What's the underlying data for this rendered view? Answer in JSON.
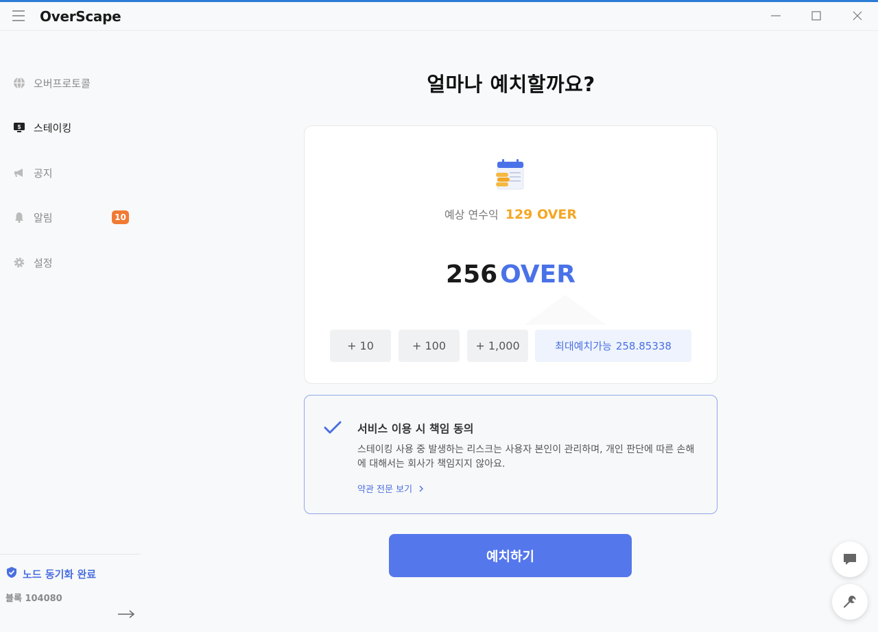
{
  "app": {
    "title": "OverScape"
  },
  "sidebar": {
    "items": [
      {
        "label": "오버프로토콜",
        "icon": "globe-icon"
      },
      {
        "label": "스테이킹",
        "icon": "staking-monitor-icon"
      },
      {
        "label": "공지",
        "icon": "megaphone-icon"
      },
      {
        "label": "알림",
        "icon": "bell-icon",
        "badge": "10"
      },
      {
        "label": "설정",
        "icon": "gear-icon"
      }
    ],
    "active_index": 1,
    "sync_status": "노드 동기화 완료",
    "block_label": "블록 104080"
  },
  "main": {
    "heading": "얼마나 예치할까요?",
    "card": {
      "yield_label": "예상 연수익",
      "yield_value": "129 OVER",
      "amount_value": "256",
      "amount_unit": "OVER",
      "increments": [
        "+ 10",
        "+ 100",
        "+ 1,000"
      ],
      "max_label": "최대예치가능",
      "max_value": "258.85338"
    },
    "consent": {
      "title": "서비스 이용 시 책임 동의",
      "body": "스테이킹 사용 중 발생하는 리스크는 사용자 본인이 관리하며, 개인 판단에 따른 손해에 대해서는 회사가 책임지지 않아요.",
      "link_label": "약관 전문 보기",
      "checked": true
    },
    "deposit_label": "예치하기"
  },
  "colors": {
    "accent": "#5577ec",
    "brand_blue": "#4a72e8",
    "yield_orange": "#f5a623",
    "badge_orange": "#f07a34"
  }
}
